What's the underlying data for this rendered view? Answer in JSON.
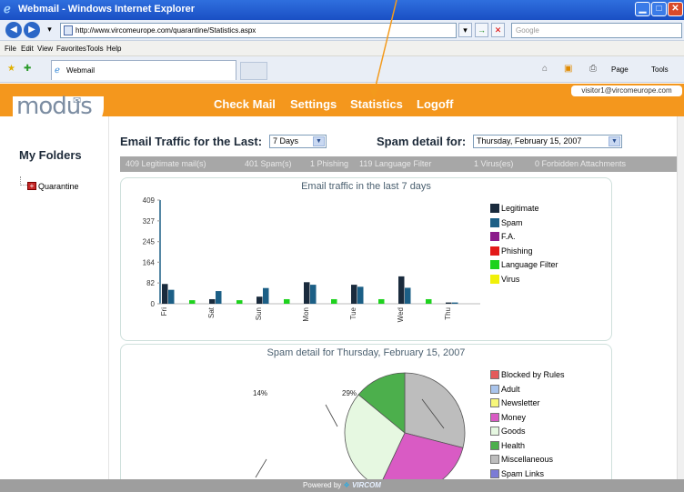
{
  "window": {
    "title": "Webmail - Windows Internet Explorer"
  },
  "address": {
    "url": "http://www.vircomeurope.com/quarantine/Statistics.aspx",
    "search_placeholder": "Google"
  },
  "menu": [
    "File",
    "Edit",
    "View",
    "Favorites",
    "Tools",
    "Help"
  ],
  "tab": {
    "label": "Webmail"
  },
  "toolbar_right": {
    "page": "Page",
    "tools": "Tools"
  },
  "header": {
    "logo": "modus",
    "nav": [
      "Check Mail",
      "Settings",
      "Statistics",
      "Logoff"
    ],
    "user": "visitor1@vircomeurope.com"
  },
  "sidebar": {
    "title": "My Folders",
    "folders": [
      "Quarantine"
    ]
  },
  "controls": {
    "traffic_label": "Email Traffic for the Last:",
    "traffic_value": "7 Days",
    "spam_label": "Spam detail for:",
    "spam_value": "Thursday, February 15, 2007"
  },
  "stats": [
    "409 Legitimate mail(s)",
    "401 Spam(s)",
    "1 Phishing",
    "119 Language Filter",
    "1 Virus(es)",
    "0 Forbidden Attachments"
  ],
  "chart_data": [
    {
      "type": "bar",
      "title": "Email traffic in the last 7 days",
      "categories": [
        "Fri",
        "Sat",
        "Sun",
        "Mon",
        "Tue",
        "Wed",
        "Thu"
      ],
      "yticks": [
        0,
        82,
        164,
        245,
        327,
        409
      ],
      "ylim": [
        0,
        409
      ],
      "series": [
        {
          "name": "Legitimate",
          "color": "#1a2b3d",
          "values": [
            78,
            18,
            28,
            85,
            75,
            108,
            5
          ]
        },
        {
          "name": "Spam",
          "color": "#1c5f86",
          "values": [
            55,
            50,
            62,
            75,
            67,
            63,
            5
          ]
        },
        {
          "name": "F.A.",
          "color": "#8b1a8b",
          "values": [
            0,
            0,
            0,
            0,
            0,
            0,
            0
          ]
        },
        {
          "name": "Phishing",
          "color": "#e31a1a",
          "values": [
            0,
            0,
            0,
            0,
            0,
            0,
            0
          ]
        },
        {
          "name": "Language Filter",
          "color": "#1ed21e",
          "values": [
            14,
            14,
            18,
            18,
            18,
            18,
            0
          ]
        },
        {
          "name": "Virus",
          "color": "#f0f00a",
          "values": [
            0,
            0,
            0,
            0,
            0,
            0,
            0
          ]
        }
      ]
    },
    {
      "type": "pie",
      "title": "Spam detail for Thursday, February 15, 2007",
      "slice_labels": [
        "14%",
        "29%"
      ],
      "legend": [
        {
          "name": "Blocked by Rules",
          "color": "#e45b5b"
        },
        {
          "name": "Adult",
          "color": "#a9c4ec"
        },
        {
          "name": "Newsletter",
          "color": "#f7f77a"
        },
        {
          "name": "Money",
          "color": "#d95bc4"
        },
        {
          "name": "Goods",
          "color": "#e6f8e1"
        },
        {
          "name": "Health",
          "color": "#4caf4c"
        },
        {
          "name": "Miscellaneous",
          "color": "#bdbdbd"
        },
        {
          "name": "Spam Links",
          "color": "#7b7bd6"
        }
      ],
      "slices": [
        {
          "name": "Miscellaneous",
          "percent": 29,
          "color": "#bdbdbd"
        },
        {
          "name": "Money",
          "percent": 28,
          "color": "#d95bc4"
        },
        {
          "name": "Goods",
          "percent": 29,
          "color": "#e6f8e1"
        },
        {
          "name": "Health",
          "percent": 14,
          "color": "#4caf4c"
        }
      ]
    }
  ],
  "footer": {
    "powered": "Powered by",
    "brand": "VIRCOM"
  }
}
